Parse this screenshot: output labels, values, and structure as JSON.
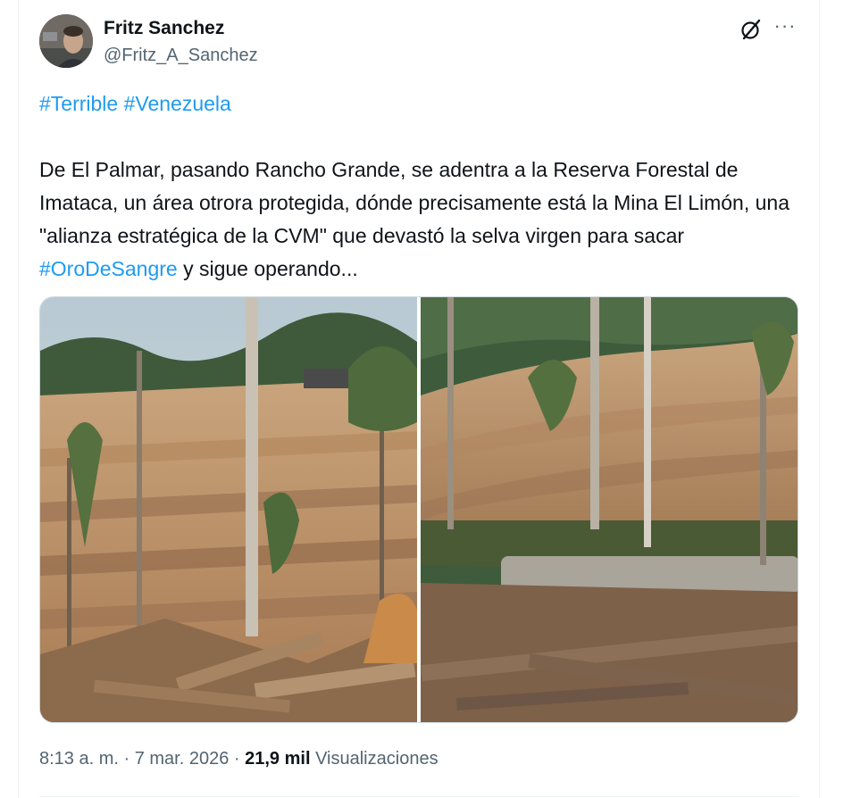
{
  "author": {
    "name": "Fritz Sanchez",
    "handle": "@Fritz_A_Sanchez"
  },
  "actions": {
    "grok_icon": "grok-icon",
    "more_icon": "more-icon",
    "more_label": "···"
  },
  "tweet": {
    "hashtags": [
      "#Terrible",
      "#Venezuela"
    ],
    "body_before": "De El Palmar, pasando Rancho Grande, se adentra a la Reserva Forestal de Imataca, un área otrora protegida, dónde precisamente está la Mina El Limón, una \"alianza estratégica de la CVM\" que devastó la selva virgen para sacar ",
    "body_hashtag": "#OroDeSangre",
    "body_after": " y sigue operando..."
  },
  "meta": {
    "time": "8:13 a. m.",
    "separator1": " · ",
    "date": "7 mar. 2026",
    "separator2": " · ",
    "views_count": "21,9 mil",
    "views_label": " Visualizaciones"
  },
  "colors": {
    "link": "#1d9bf0",
    "text": "#0f1419",
    "secondary": "#536471"
  }
}
